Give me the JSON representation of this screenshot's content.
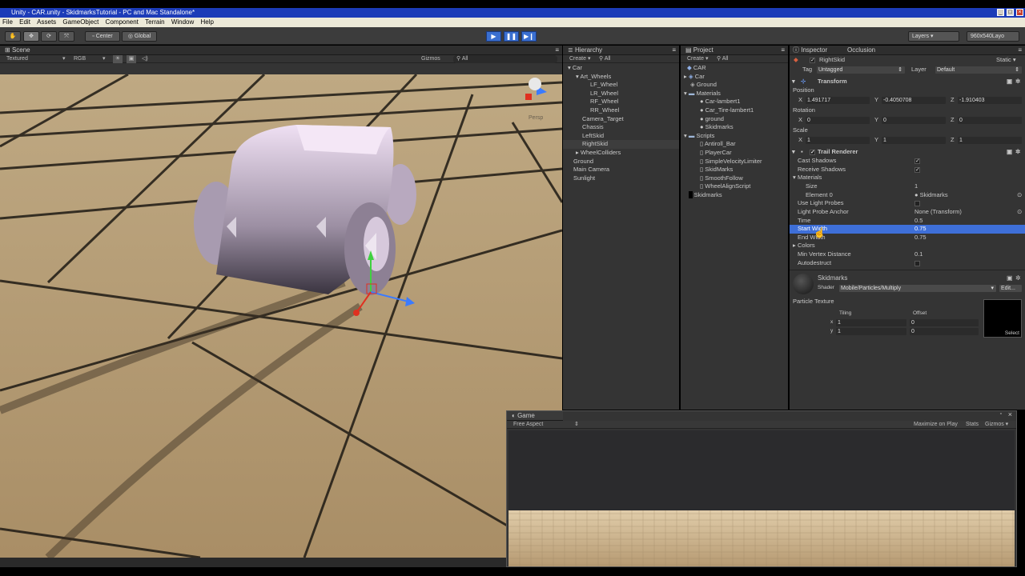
{
  "window": {
    "title": "Unity - CAR.unity - SkidmarksTutorial - PC and Mac Standalone*"
  },
  "menu": [
    "File",
    "Edit",
    "Assets",
    "GameObject",
    "Component",
    "Terrain",
    "Window",
    "Help"
  ],
  "toolbar": {
    "pivot": "Center",
    "space": "Global",
    "layers": "Layers",
    "layout": "960x540Layo"
  },
  "scene": {
    "tab": "Scene",
    "shading": "Textured",
    "render": "RGB",
    "gizmos": "Gizmos",
    "search": "All",
    "gizmo_label": "Persp"
  },
  "hierarchy": {
    "tab": "Hierarchy",
    "create": "Create",
    "search": "All",
    "items": [
      "Car",
      "Art_Wheels",
      "LF_Wheel",
      "LR_Wheel",
      "RF_Wheel",
      "RR_Wheel",
      "Camera_Target",
      "Chassis",
      "LeftSkid",
      "RightSkid",
      "WheelColliders",
      "Ground",
      "Main Camera",
      "Sunlight"
    ]
  },
  "project": {
    "tab": "Project",
    "create": "Create",
    "search": "All",
    "items": [
      "CAR",
      "Car",
      "Ground",
      "Materials",
      "Car-lambert1",
      "Car_Tire-lambert1",
      "ground",
      "Skidmarks",
      "Scripts",
      "Antiroll_Bar",
      "PlayerCar",
      "SimpleVelocityLimiter",
      "SkidMarks",
      "SmoothFollow",
      "WheelAlignScript",
      "Skidmarks"
    ]
  },
  "inspector": {
    "tab": "Inspector",
    "tab2": "Occlusion",
    "object_name": "RightSkid",
    "static": "Static",
    "tag_label": "Tag",
    "tag": "Untagged",
    "layer_label": "Layer",
    "layer": "Default",
    "transform": "Transform",
    "position_label": "Position",
    "position": {
      "x": "1.491717",
      "y": "-0.4050708",
      "z": "-1.910403"
    },
    "rotation_label": "Rotation",
    "rotation": {
      "x": "0",
      "y": "0",
      "z": "0"
    },
    "scale_label": "Scale",
    "scale": {
      "x": "1",
      "y": "1",
      "z": "1"
    },
    "trail": "Trail Renderer",
    "cast_shadows": "Cast Shadows",
    "receive_shadows": "Receive Shadows",
    "materials": "Materials",
    "size_label": "Size",
    "size": "1",
    "element0_label": "Element 0",
    "element0": "Skidmarks",
    "use_light_probes": "Use Light Probes",
    "light_probe_anchor_label": "Light Probe Anchor",
    "light_probe_anchor": "None (Transform)",
    "time_label": "Time",
    "time": "0.5",
    "start_width_label": "Start Width",
    "start_width": "0.75",
    "end_width_label": "End Width",
    "end_width": "0.75",
    "colors": "Colors",
    "min_vertex_label": "Min Vertex Distance",
    "min_vertex": "0.1",
    "autodestruct": "Autodestruct",
    "material_name": "Skidmarks",
    "shader_label": "Shader",
    "shader": "Mobile/Particles/Multiply",
    "edit": "Edit...",
    "particle_texture": "Particle Texture",
    "tiling": "Tiling",
    "offset": "Offset",
    "tiling_x": "1",
    "tiling_y": "1",
    "offset_x": "0",
    "offset_y": "0",
    "select": "Select"
  },
  "game": {
    "tab": "Game",
    "aspect": "Free Aspect",
    "maximize": "Maximize on Play",
    "stats": "Stats",
    "gizmos": "Gizmos"
  }
}
